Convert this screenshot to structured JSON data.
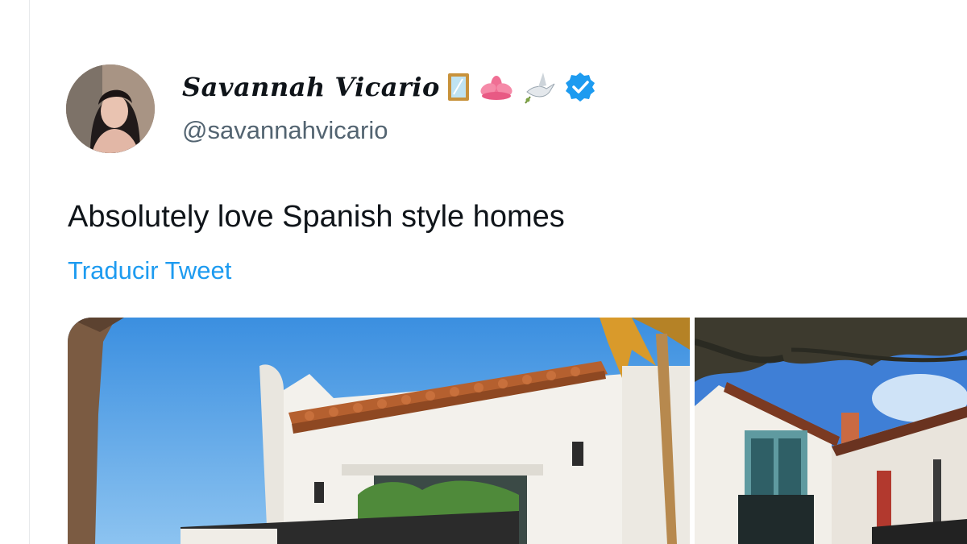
{
  "author": {
    "display_name": "Savannah Vicario",
    "handle": "@savannahvicario",
    "name_icons": [
      "mirror-icon",
      "lotus-icon",
      "dove-icon",
      "verified-badge-icon"
    ],
    "verified_color": "#1d9bf0"
  },
  "tweet": {
    "text": "Absolutely love Spanish style homes",
    "translate_label": "Traducir Tweet"
  },
  "media": {
    "count_visible": 2,
    "photos": [
      "spanish-house-photo",
      "courtyard-house-photo"
    ]
  },
  "colors": {
    "text_primary": "#0f1419",
    "text_secondary": "#536471",
    "link": "#1d9bf0"
  }
}
